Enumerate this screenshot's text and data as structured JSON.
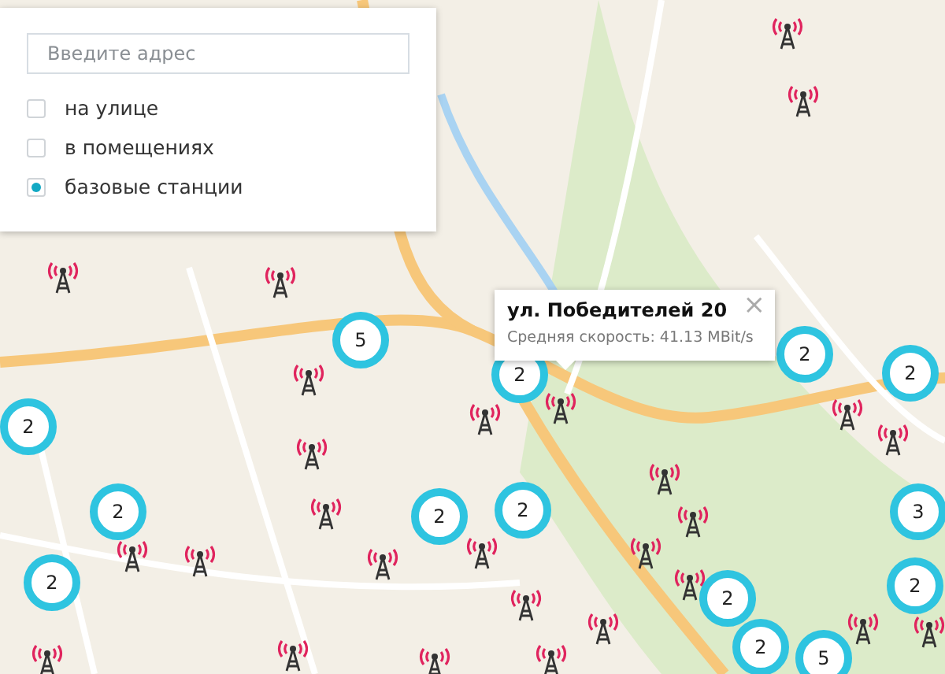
{
  "search": {
    "placeholder": "Введите адрес"
  },
  "filters": [
    {
      "label": "на улице",
      "checked": false
    },
    {
      "label": "в помещениях",
      "checked": false
    },
    {
      "label": "базовые станции",
      "checked": true
    }
  ],
  "popup": {
    "title": "ул. Победителей 20",
    "text": "Средняя скорость: 41.13 MBit/s",
    "close": "×"
  },
  "clusters": [
    {
      "count": "5"
    },
    {
      "count": "2"
    },
    {
      "count": "2"
    },
    {
      "count": "2"
    },
    {
      "count": "2"
    },
    {
      "count": "2"
    },
    {
      "count": "2"
    },
    {
      "count": "2"
    },
    {
      "count": "3"
    },
    {
      "count": "2"
    },
    {
      "count": "2"
    },
    {
      "count": "2"
    },
    {
      "count": "2"
    },
    {
      "count": "5"
    }
  ]
}
